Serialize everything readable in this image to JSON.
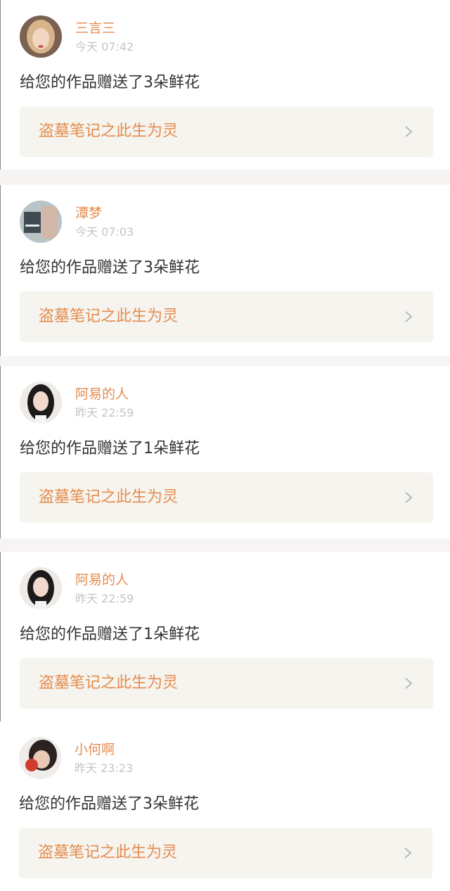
{
  "notifications": [
    {
      "user_name": "三言三",
      "time": "今天 07:42",
      "message": "给您的作品赠送了3朵鲜花",
      "work_title": "盗墓笔记之此生为灵",
      "avatar": "avatar-woman-blonde"
    },
    {
      "user_name": "潭梦",
      "time": "今天 07:03",
      "message": "给您的作品赠送了3朵鲜花",
      "work_title": "盗墓笔记之此生为灵",
      "avatar": "avatar-scene-pale"
    },
    {
      "user_name": "阿易的人",
      "time": "昨天 22:59",
      "message": "给您的作品赠送了1朵鲜花",
      "work_title": "盗墓笔记之此生为灵",
      "avatar": "avatar-girl-dark-hair"
    },
    {
      "user_name": "阿易的人",
      "time": "昨天 22:59",
      "message": "给您的作品赠送了1朵鲜花",
      "work_title": "盗墓笔记之此生为灵",
      "avatar": "avatar-girl-dark-hair"
    },
    {
      "user_name": "小何啊",
      "time": "昨天 23:23",
      "message": "给您的作品赠送了3朵鲜花",
      "work_title": "盗墓笔记之此生为灵",
      "avatar": "avatar-person-red-apple"
    }
  ],
  "icons": {
    "work_link_arrow": "chevron-right-icon"
  },
  "colors": {
    "accent": "#e58b4f",
    "time_text": "#c4c4c4",
    "message_text": "#333333",
    "link_background": "#f5f4ee",
    "page_background": "#f7f5f4"
  }
}
